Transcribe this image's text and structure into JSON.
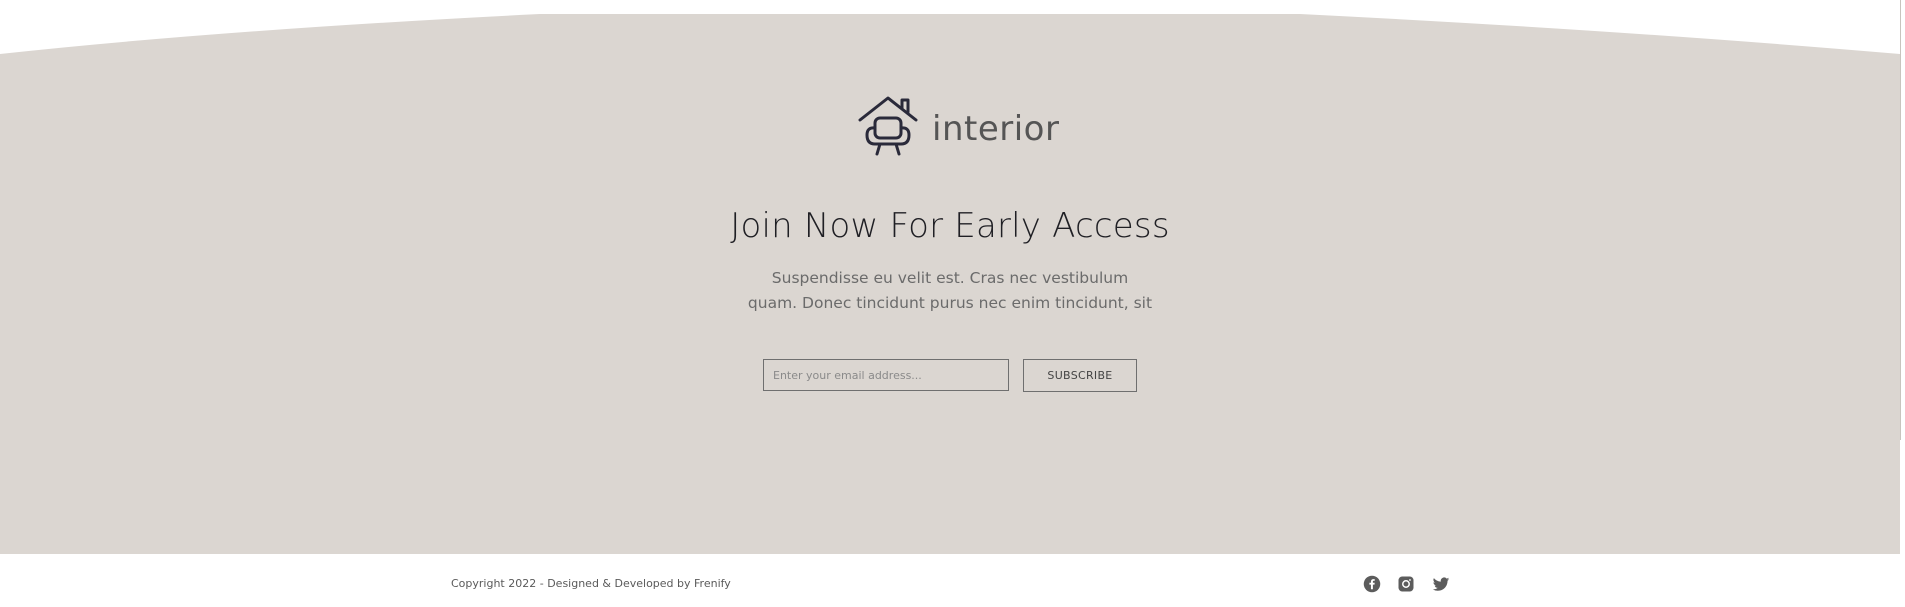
{
  "brand": {
    "name": "interior",
    "logo_icon": "house-armchair-icon"
  },
  "hero": {
    "headline": "Join Now For Early Access",
    "description_line1": "Suspendisse eu velit est. Cras nec vestibulum",
    "description_line2": "quam. Donec tincidunt purus nec enim tincidunt, sit"
  },
  "subscribe_form": {
    "email_placeholder": "Enter your email address...",
    "email_value": "",
    "button_label": "SUBSCRIBE"
  },
  "footer": {
    "copyright": "Copyright 2022 - Designed & Developed by Frenify",
    "social_icons": [
      "facebook-icon",
      "instagram-icon",
      "twitter-icon"
    ]
  },
  "colors": {
    "section_background": "#dbd6d1",
    "page_background": "#ffffff",
    "logo_icon_color": "#2a2a3a",
    "heading_color": "#1f1f24",
    "body_text_color": "#6b6b6b",
    "social_icon_color": "#5c5c5c"
  }
}
